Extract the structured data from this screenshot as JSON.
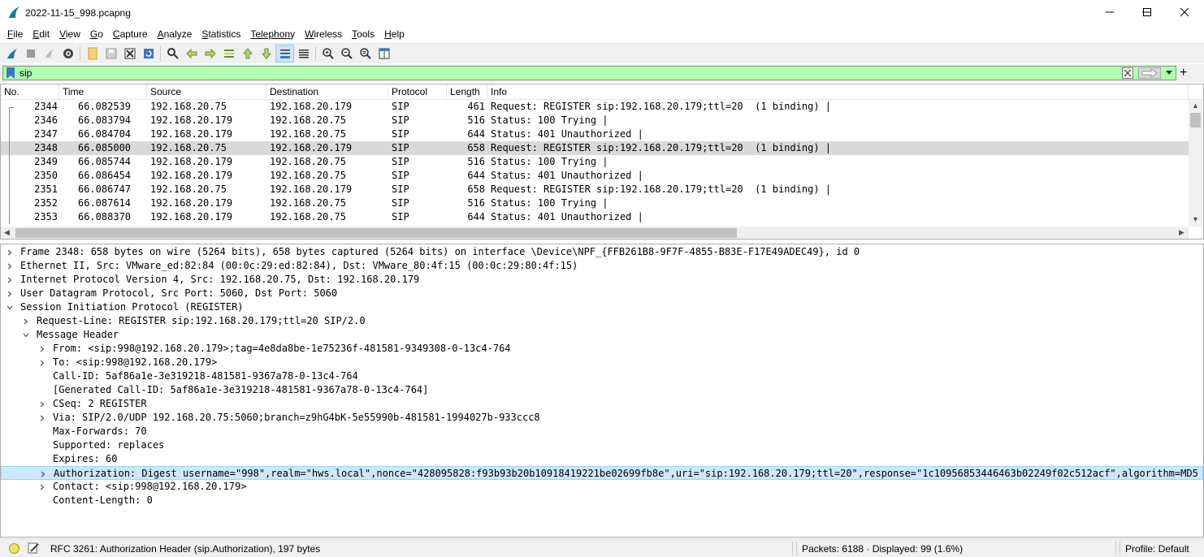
{
  "window": {
    "title": "2022-11-15_998.pcapng"
  },
  "menu": [
    {
      "label": "File",
      "u": "F",
      "rest": "ile"
    },
    {
      "label": "Edit",
      "u": "E",
      "rest": "dit"
    },
    {
      "label": "View",
      "u": "V",
      "rest": "iew"
    },
    {
      "label": "Go",
      "u": "G",
      "rest": "o"
    },
    {
      "label": "Capture",
      "u": "C",
      "rest": "apture"
    },
    {
      "label": "Analyze",
      "u": "A",
      "rest": "nalyze"
    },
    {
      "label": "Statistics",
      "u": "S",
      "rest": "tatistics"
    },
    {
      "label": "Telephony",
      "u": "Telephon",
      "rest": "y"
    },
    {
      "label": "Wireless",
      "u": "W",
      "rest": "ireless"
    },
    {
      "label": "Tools",
      "u": "T",
      "rest": "ools"
    },
    {
      "label": "Help",
      "u": "H",
      "rest": "elp"
    }
  ],
  "filter": {
    "value": "sip"
  },
  "packet_list": {
    "columns": [
      "No.",
      "Time",
      "Source",
      "Destination",
      "Protocol",
      "Length",
      "Info"
    ],
    "rows": [
      {
        "no": "2344",
        "time": "66.082539",
        "src": "192.168.20.75",
        "dst": "192.168.20.179",
        "proto": "SIP",
        "len": "461",
        "info": "Request: REGISTER sip:192.168.20.179;ttl=20  (1 binding) |"
      },
      {
        "no": "2346",
        "time": "66.083794",
        "src": "192.168.20.179",
        "dst": "192.168.20.75",
        "proto": "SIP",
        "len": "516",
        "info": "Status: 100 Trying |"
      },
      {
        "no": "2347",
        "time": "66.084704",
        "src": "192.168.20.179",
        "dst": "192.168.20.75",
        "proto": "SIP",
        "len": "644",
        "info": "Status: 401 Unauthorized |"
      },
      {
        "no": "2348",
        "time": "66.085000",
        "src": "192.168.20.75",
        "dst": "192.168.20.179",
        "proto": "SIP",
        "len": "658",
        "info": "Request: REGISTER sip:192.168.20.179;ttl=20  (1 binding) |"
      },
      {
        "no": "2349",
        "time": "66.085744",
        "src": "192.168.20.179",
        "dst": "192.168.20.75",
        "proto": "SIP",
        "len": "516",
        "info": "Status: 100 Trying |"
      },
      {
        "no": "2350",
        "time": "66.086454",
        "src": "192.168.20.179",
        "dst": "192.168.20.75",
        "proto": "SIP",
        "len": "644",
        "info": "Status: 401 Unauthorized |"
      },
      {
        "no": "2351",
        "time": "66.086747",
        "src": "192.168.20.75",
        "dst": "192.168.20.179",
        "proto": "SIP",
        "len": "658",
        "info": "Request: REGISTER sip:192.168.20.179;ttl=20  (1 binding) |"
      },
      {
        "no": "2352",
        "time": "66.087614",
        "src": "192.168.20.179",
        "dst": "192.168.20.75",
        "proto": "SIP",
        "len": "516",
        "info": "Status: 100 Trying |"
      },
      {
        "no": "2353",
        "time": "66.088370",
        "src": "192.168.20.179",
        "dst": "192.168.20.75",
        "proto": "SIP",
        "len": "644",
        "info": "Status: 401 Unauthorized |"
      }
    ]
  },
  "details": [
    {
      "indent": 0,
      "exp": "collapsed",
      "text": "Frame 2348: 658 bytes on wire (5264 bits), 658 bytes captured (5264 bits) on interface \\Device\\NPF_{FFB261B8-9F7F-4855-B83E-F17E49ADEC49}, id 0"
    },
    {
      "indent": 0,
      "exp": "collapsed",
      "text": "Ethernet II, Src: VMware_ed:82:84 (00:0c:29:ed:82:84), Dst: VMware_80:4f:15 (00:0c:29:80:4f:15)"
    },
    {
      "indent": 0,
      "exp": "collapsed",
      "text": "Internet Protocol Version 4, Src: 192.168.20.75, Dst: 192.168.20.179"
    },
    {
      "indent": 0,
      "exp": "collapsed",
      "text": "User Datagram Protocol, Src Port: 5060, Dst Port: 5060"
    },
    {
      "indent": 0,
      "exp": "expanded",
      "text": "Session Initiation Protocol (REGISTER)"
    },
    {
      "indent": 1,
      "exp": "collapsed",
      "text": "Request-Line: REGISTER sip:192.168.20.179;ttl=20 SIP/2.0"
    },
    {
      "indent": 1,
      "exp": "expanded",
      "text": "Message Header"
    },
    {
      "indent": 2,
      "exp": "collapsed",
      "text": "From: <sip:998@192.168.20.179>;tag=4e8da8be-1e75236f-481581-9349308-0-13c4-764"
    },
    {
      "indent": 2,
      "exp": "collapsed",
      "text": "To: <sip:998@192.168.20.179>"
    },
    {
      "indent": 2,
      "exp": "none",
      "text": "Call-ID: 5af86a1e-3e319218-481581-9367a78-0-13c4-764"
    },
    {
      "indent": 2,
      "exp": "none",
      "text": "[Generated Call-ID: 5af86a1e-3e319218-481581-9367a78-0-13c4-764]"
    },
    {
      "indent": 2,
      "exp": "collapsed",
      "text": "CSeq: 2 REGISTER"
    },
    {
      "indent": 2,
      "exp": "collapsed",
      "text": "Via: SIP/2.0/UDP 192.168.20.75:5060;branch=z9hG4bK-5e55990b-481581-1994027b-933ccc8"
    },
    {
      "indent": 2,
      "exp": "none",
      "text": "Max-Forwards: 70"
    },
    {
      "indent": 2,
      "exp": "none",
      "text": "Supported: replaces"
    },
    {
      "indent": 2,
      "exp": "none",
      "text": "Expires: 60"
    },
    {
      "indent": 2,
      "exp": "collapsed",
      "text": "Authorization: Digest username=\"998\",realm=\"hws.local\",nonce=\"428095828:f93b93b20b10918419221be02699fb8e\",uri=\"sip:192.168.20.179;ttl=20\",response=\"1c10956853446463b02249f02c512acf\",algorithm=MD5",
      "highlight": true
    },
    {
      "indent": 2,
      "exp": "collapsed",
      "text": "Contact: <sip:998@192.168.20.179>"
    },
    {
      "indent": 2,
      "exp": "none",
      "text": "Content-Length: 0"
    }
  ],
  "status": {
    "field_info": "RFC 3261: Authorization Header (sip.Authorization), 197 bytes",
    "packets": "Packets: 6188 · Displayed: 99 (1.6%)",
    "profile": "Profile: Default"
  },
  "colors": {
    "filter_ok": "#afffaf",
    "selected_row": "#d9d9d9",
    "highlight_row": "#cce8ff"
  }
}
